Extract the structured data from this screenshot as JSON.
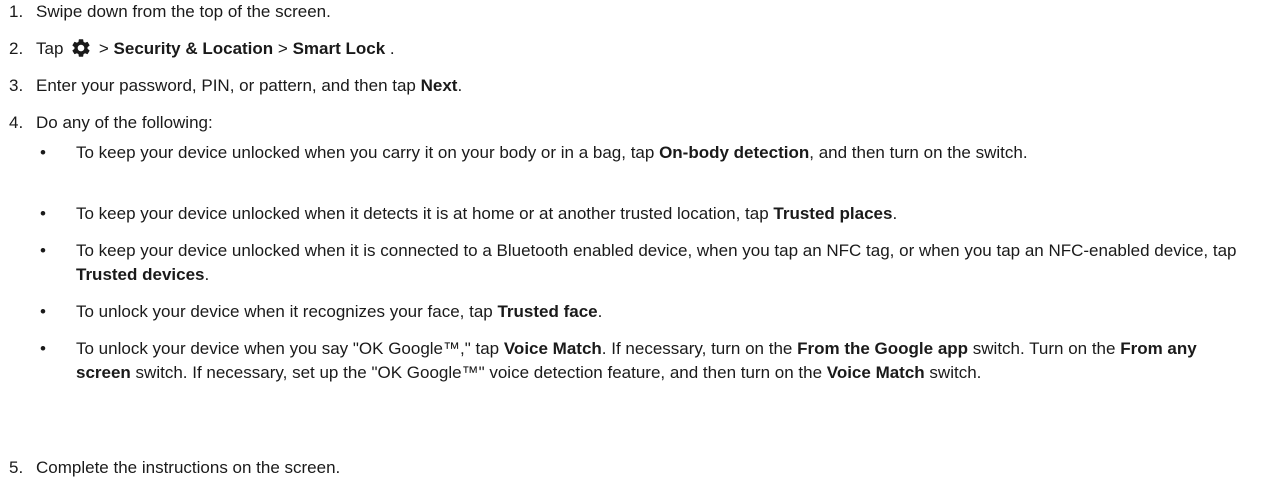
{
  "steps": [
    {
      "num": "1.",
      "text": "Swipe down from the top of the screen."
    },
    {
      "num": "2.",
      "t1": "Tap ",
      "t2": " > ",
      "b1": "Security & Location",
      "t3": " > ",
      "b2": "Smart Lock",
      "t4": ".",
      "icon": "settings-gear-icon"
    },
    {
      "num": "3.",
      "t1": "Enter your password, PIN, or pattern, and then tap ",
      "b1": "Next",
      "t2": "."
    },
    {
      "num": "4.",
      "text": "Do any of the following:"
    },
    {
      "num": "5.",
      "text": "Complete the instructions on the screen."
    }
  ],
  "bullets": [
    {
      "mark": "•",
      "t1": "To keep your device unlocked when you carry it on your body or in a bag, tap ",
      "b1": "On-body detection",
      "t2": ", and then turn on the switch."
    },
    {
      "mark": "•",
      "t1": "To keep your device unlocked when it detects it is at home or at another trusted location, tap ",
      "b1": "Trusted places",
      "t2": "."
    },
    {
      "mark": "•",
      "t1": "To keep your device unlocked when it is connected to a Bluetooth enabled device, when you tap an NFC tag, or when you tap an NFC-enabled device, tap ",
      "b1": "Trusted devices",
      "t2": "."
    },
    {
      "mark": "•",
      "t1": "To unlock your device when it recognizes your face, tap ",
      "b1": "Trusted face",
      "t2": "."
    },
    {
      "mark": "•",
      "t1": "To unlock your device when you say \"OK Google™,\" tap ",
      "b1": "Voice Match",
      "t2": ". If necessary, turn on the ",
      "b2": "From the Google app",
      "t3": " switch. Turn on the ",
      "b3": "From any screen",
      "t4": " switch. If necessary, set up the \"OK Google™\" voice detection feature, and then turn on the ",
      "b4": "Voice Match",
      "t5": " switch."
    }
  ]
}
